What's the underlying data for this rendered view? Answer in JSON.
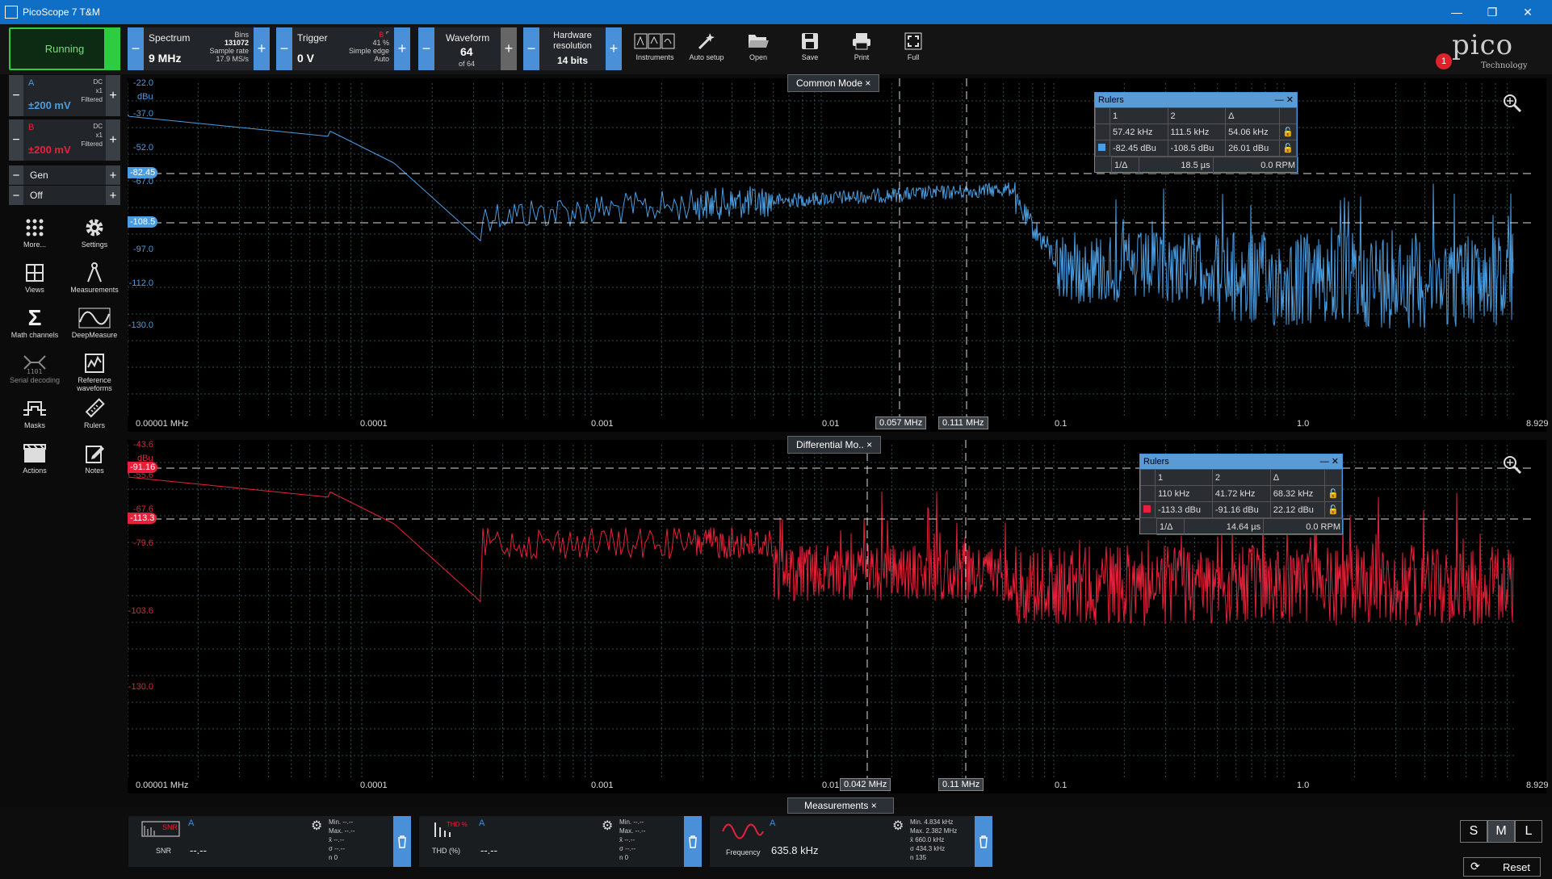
{
  "window": {
    "title": "PicoScope 7 T&M"
  },
  "toolbar": {
    "run_label": "Running",
    "mode": {
      "label": "Spectrum",
      "value": "9 MHz",
      "bins_label": "Bins",
      "bins": "131072",
      "rate_label": "Sample rate",
      "rate": "17.9 MS/s"
    },
    "trigger": {
      "label": "Trigger",
      "value": "0 V",
      "channel": "B",
      "percent": "41 %",
      "type": "Simple edge",
      "mode": "Auto"
    },
    "waveform": {
      "label": "Waveform",
      "value": "64",
      "of": "of 64"
    },
    "resolution": {
      "label": "Hardware resolution",
      "value": "14 bits"
    },
    "buttons": [
      {
        "label": "Instruments",
        "icon": "instruments-icon"
      },
      {
        "label": "Auto setup",
        "icon": "auto-setup-icon"
      },
      {
        "label": "Open",
        "icon": "folder-open-icon"
      },
      {
        "label": "Save",
        "icon": "save-icon"
      },
      {
        "label": "Print",
        "icon": "print-icon"
      },
      {
        "label": "Full",
        "icon": "fullscreen-icon"
      }
    ],
    "logo": {
      "text": "pico",
      "sub": "Technology",
      "badge": "1"
    }
  },
  "channels": [
    {
      "name": "A",
      "range": "±200 mV",
      "coupling": "DC",
      "probe": "x1",
      "filter": "Filtered",
      "color": "#4a9de0"
    },
    {
      "name": "B",
      "range": "±200 mV",
      "coupling": "DC",
      "probe": "x1",
      "filter": "Filtered",
      "color": "#e8203a"
    }
  ],
  "gen": {
    "label": "Gen",
    "state": "Off"
  },
  "tools": [
    {
      "label": "More...",
      "icon": "more-grid-icon"
    },
    {
      "label": "Settings",
      "icon": "gear-icon"
    },
    {
      "label": "Views",
      "icon": "views-icon"
    },
    {
      "label": "Measurements",
      "icon": "measurements-icon"
    },
    {
      "label": "Math channels",
      "icon": "sigma-icon"
    },
    {
      "label": "DeepMeasure",
      "icon": "deepmeasure-icon"
    },
    {
      "label": "Serial decoding",
      "icon": "serial-decoding-icon"
    },
    {
      "label": "Reference waveforms",
      "icon": "reference-waveforms-icon"
    },
    {
      "label": "Masks",
      "icon": "masks-icon"
    },
    {
      "label": "Rulers",
      "icon": "ruler-icon"
    },
    {
      "label": "Actions",
      "icon": "actions-icon"
    },
    {
      "label": "Notes",
      "icon": "notes-icon"
    }
  ],
  "panels": [
    {
      "title": "Common Mode",
      "color": "#4a9de0",
      "unit": "dBu",
      "yticks": [
        "-22.0",
        "-37.0",
        "-52.0",
        "-67.0",
        "-82.45",
        "-97.0",
        "-112.0",
        "-130.0"
      ],
      "xticks": [
        "0.00001 MHz",
        "0.0001",
        "0.001",
        "0.01",
        "0.1",
        "1.0",
        "8.929"
      ],
      "ruler_y": [
        "-82.45",
        "-108.5"
      ],
      "ruler_x": [
        "0.057 MHz",
        "0.111 MHz"
      ],
      "rulers": {
        "title": "Rulers",
        "h": [
          "1",
          "2",
          "Δ"
        ],
        "row1": [
          "57.42 kHz",
          "111.5 kHz",
          "54.06 kHz"
        ],
        "row2": [
          "-82.45 dBu",
          "-108.5 dBu",
          "26.01 dBu"
        ],
        "row3": [
          "1/Δ",
          "18.5 µs",
          "0.0 RPM"
        ]
      }
    },
    {
      "title": "Differential Mo..",
      "color": "#e8203a",
      "unit": "dBu",
      "yticks": [
        "-43.6",
        "-55.6",
        "-67.6",
        "-79.6",
        "-91.16",
        "-103.6",
        "-113.3",
        "-130.0"
      ],
      "xticks": [
        "0.00001 MHz",
        "0.0001",
        "0.001",
        "0.01",
        "0.1",
        "1.0",
        "8.929"
      ],
      "ruler_y": [
        "-91.16",
        "-113.3"
      ],
      "ruler_x": [
        "0.042 MHz",
        "0.11 MHz"
      ],
      "rulers": {
        "title": "Rulers",
        "h": [
          "1",
          "2",
          "Δ"
        ],
        "row1": [
          "110 kHz",
          "41.72 kHz",
          "68.32 kHz"
        ],
        "row2": [
          "-113.3 dBu",
          "-91.16 dBu",
          "22.12 dBu"
        ],
        "row3": [
          "1/Δ",
          "14.64 µs",
          "0.0 RPM"
        ]
      }
    }
  ],
  "measurements": {
    "tab": "Measurements",
    "cards": [
      {
        "name": "SNR",
        "channel": "A",
        "value": "--.--",
        "icon": "snr-icon",
        "stats": [
          "Min.  --.--",
          "Max.  --.--",
          "x̄     --.--",
          "σ     --.--",
          "n     0"
        ]
      },
      {
        "name": "THD (%)",
        "channel": "A",
        "value": "--.--",
        "icon": "thd-icon",
        "stats": [
          "Min.  --.--",
          "Max.  --.--",
          "x̄     --.--",
          "σ     --.--",
          "n     0"
        ]
      },
      {
        "name": "Frequency",
        "channel": "A",
        "value": "635.8 kHz",
        "icon": "sine-wave-icon",
        "stats": [
          "Min.  4.834 kHz",
          "Max.  2.382 MHz",
          "x̄     660.0 kHz",
          "σ     434.3 kHz",
          "n     135"
        ]
      }
    ],
    "sizes": [
      "S",
      "M",
      "L"
    ],
    "reset": "Reset"
  }
}
